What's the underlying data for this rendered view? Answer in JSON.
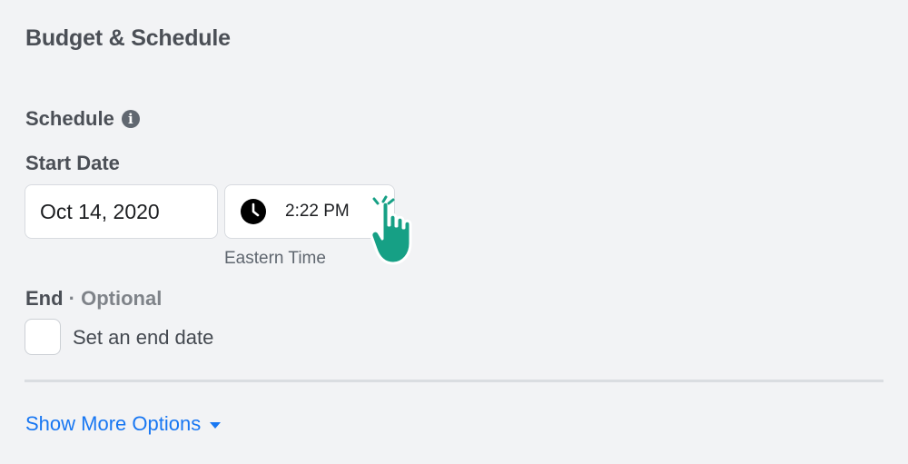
{
  "section": {
    "title": "Budget & Schedule"
  },
  "schedule": {
    "label": "Schedule",
    "info_icon": "info-icon",
    "start_label": "Start Date",
    "start_date": "Oct 14, 2020",
    "start_time": "2:22 PM",
    "timezone": "Eastern Time",
    "clock_icon": "clock-icon"
  },
  "end": {
    "label": "End",
    "separator": " · ",
    "optional": "Optional",
    "checkbox_label": "Set an end date",
    "checked": false
  },
  "more_options": {
    "label": "Show More Options",
    "caret_icon": "caret-down-icon"
  },
  "cursor": {
    "icon": "pointer-hand-icon",
    "color": "#16a085"
  },
  "colors": {
    "link": "#1877f2",
    "background": "#f2f3f5"
  }
}
